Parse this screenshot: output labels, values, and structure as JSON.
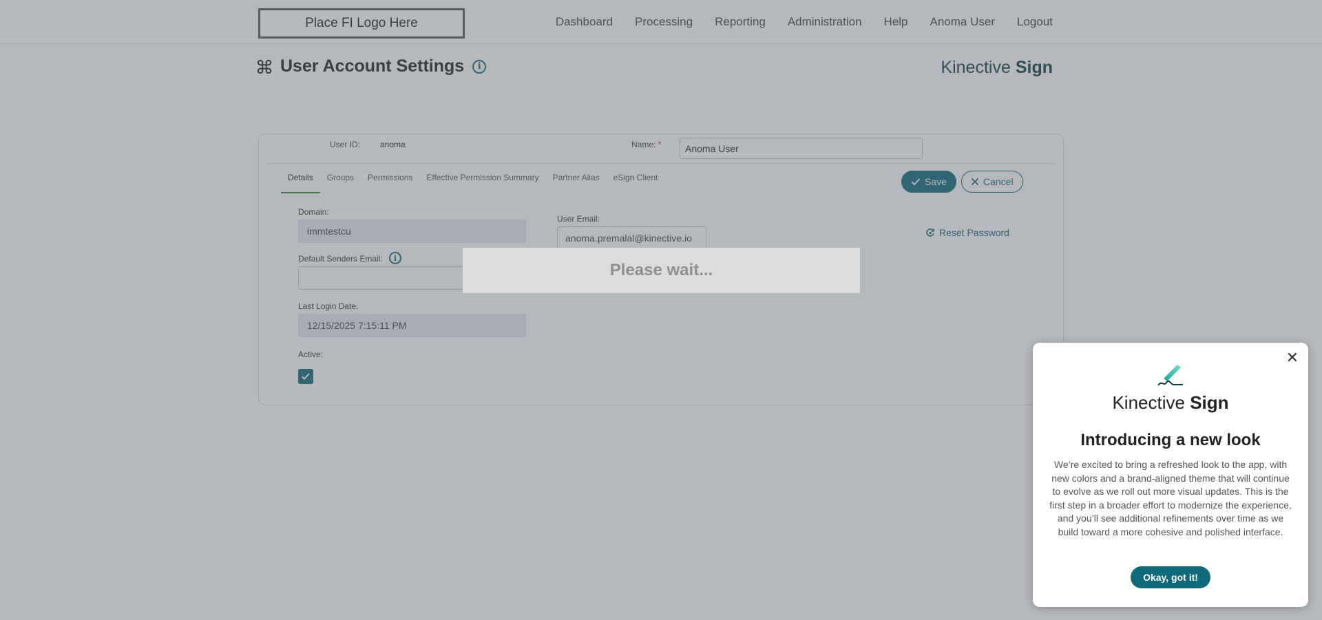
{
  "header": {
    "logo_placeholder": "Place FI Logo Here",
    "nav": [
      "Dashboard",
      "Processing",
      "Reporting",
      "Administration",
      "Help",
      "Anoma User",
      "Logout"
    ]
  },
  "page": {
    "title": "User Account Settings",
    "brand_light": "Kinective",
    "brand_bold": "Sign"
  },
  "form": {
    "user_id_label": "User ID:",
    "user_id_value": "anoma",
    "name_label": "Name:",
    "required_mark": "*",
    "name_value": "Anoma User",
    "tabs": [
      "Details",
      "Groups",
      "Permissions",
      "Effective Permission Summary",
      "Partner Alias",
      "eSign Client"
    ],
    "save_label": "Save",
    "cancel_label": "Cancel",
    "domain_label": "Domain:",
    "domain_value": "immtestcu",
    "default_senders_email_label": "Default Senders Email:",
    "default_senders_email_value": "",
    "user_email_label": "User Email:",
    "user_email_value": "anoma.premalal@kinective.io",
    "reset_password_label": "Reset Password",
    "last_login_label": "Last Login Date:",
    "last_login_value": "12/15/2025 7:15:11 PM",
    "active_label": "Active:",
    "active_checked": true
  },
  "loading": {
    "text": "Please wait..."
  },
  "popup": {
    "brand_light": "Kinective",
    "brand_bold": "Sign",
    "heading": "Introducing a new look",
    "body": "We’re excited to bring a refreshed look to the app, with new colors and a brand-aligned theme that will continue to evolve as we roll out more visual updates. This is the first step in a broader effort to modernize the experience, and you’ll see additional refinements over time as we build toward a more cohesive and polished interface.",
    "ok_label": "Okay, got it!"
  },
  "colors": {
    "accent": "#0e6a78",
    "tab_active_underline": "#2e7d32",
    "required": "#c62828"
  },
  "icons": {
    "title": "command-icon",
    "info": "info-icon",
    "save": "check-icon",
    "cancel": "x-icon",
    "reset": "reset-icon",
    "close": "close-icon",
    "popup_logo": "pen-signature-icon"
  }
}
